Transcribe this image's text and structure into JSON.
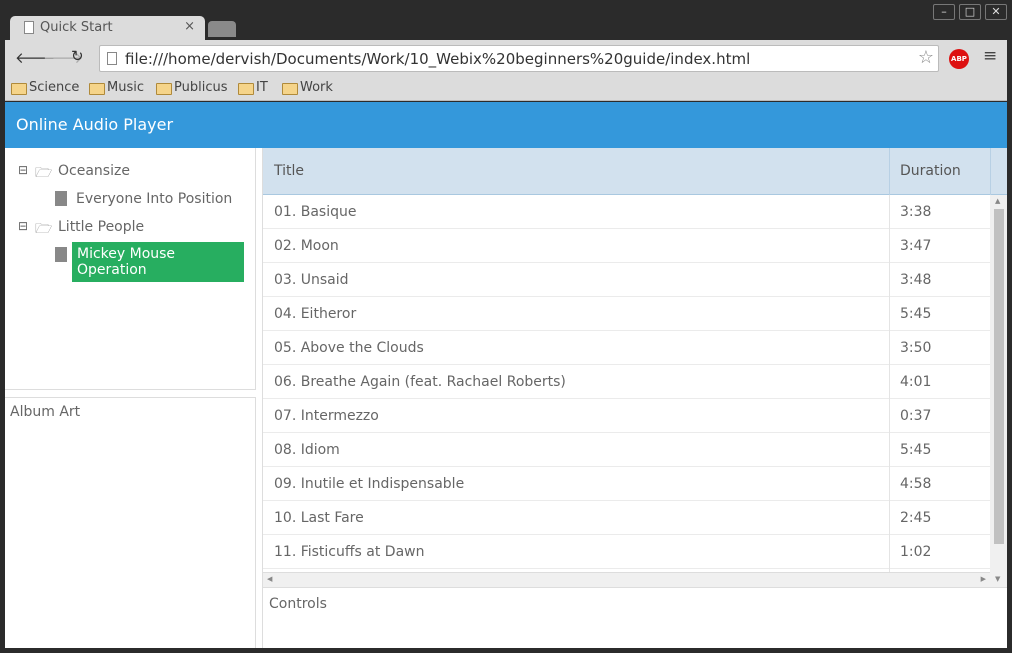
{
  "browser": {
    "tab_title": "Quick Start",
    "url": "file:///home/dervish/Documents/Work/10_Webix%20beginners%20guide/index.html",
    "bookmarks": [
      "Science",
      "Music",
      "Publicus",
      "IT",
      "Work"
    ],
    "adblock_label": "ABP"
  },
  "app": {
    "title": "Online Audio Player",
    "tree": [
      {
        "label": "Oceansize",
        "children": [
          "Everyone Into Position"
        ]
      },
      {
        "label": "Little People",
        "children": [
          "Mickey Mouse Operation"
        ]
      }
    ],
    "selected": "Mickey Mouse Operation",
    "album_art_label": "Album Art",
    "controls_label": "Controls",
    "columns": {
      "title": "Title",
      "duration": "Duration"
    },
    "tracks": [
      {
        "title": "01. Basique",
        "duration": "3:38"
      },
      {
        "title": "02. Moon",
        "duration": "3:47"
      },
      {
        "title": "03. Unsaid",
        "duration": "3:48"
      },
      {
        "title": "04. Eitheror",
        "duration": "5:45"
      },
      {
        "title": "05. Above the Clouds",
        "duration": "3:50"
      },
      {
        "title": "06. Breathe Again (feat. Rachael Roberts)",
        "duration": "4:01"
      },
      {
        "title": "07. Intermezzo",
        "duration": "0:37"
      },
      {
        "title": "08. Idiom",
        "duration": "5:45"
      },
      {
        "title": "09. Inutile et Indispensable",
        "duration": "4:58"
      },
      {
        "title": "10. Last Fare",
        "duration": "2:45"
      },
      {
        "title": "11. Fisticuffs at Dawn",
        "duration": "1:02"
      }
    ]
  },
  "colors": {
    "header": "#3498db",
    "selected": "#27ae60",
    "grid_header": "#d2e1ee"
  }
}
